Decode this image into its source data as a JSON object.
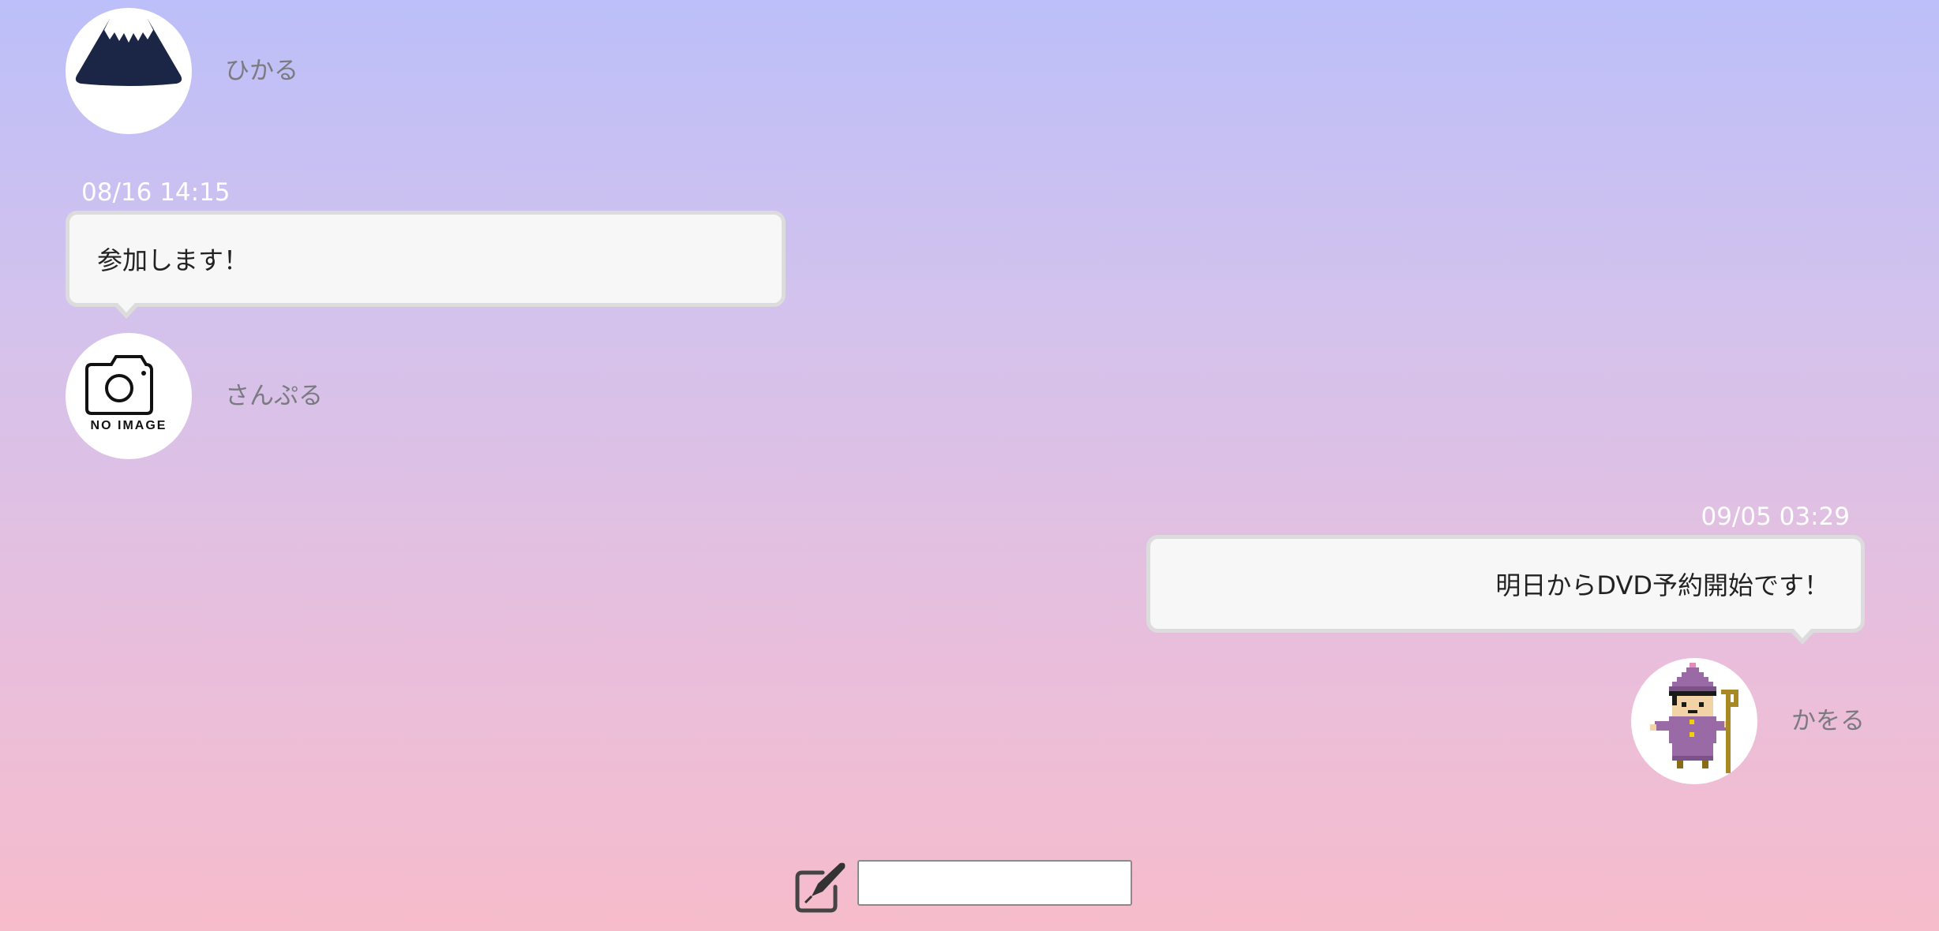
{
  "messages": [
    {
      "user": "ひかる",
      "avatar": "mount-fuji-icon",
      "align": "left"
    },
    {
      "timestamp": "08/16 14:15",
      "text": "参加します！",
      "user": "さんぷる",
      "avatar": "camera-no-image-icon",
      "avatar_caption": "NO IMAGE",
      "align": "left"
    },
    {
      "timestamp": "09/05 03:29",
      "text": "明日からDVD予約開始です！",
      "user": "かをる",
      "avatar": "pixel-wizard-icon",
      "align": "right"
    }
  ],
  "composer": {
    "icon": "compose-pen-icon",
    "input_value": "",
    "input_placeholder": ""
  },
  "colors": {
    "background_top": "#bcbff9",
    "background_bottom": "#f6bccb",
    "bubble_fill": "#f7f7f7",
    "bubble_border": "#dcdcdc",
    "username_text": "#7a7a80",
    "timestamp_text": "#ffffff"
  }
}
